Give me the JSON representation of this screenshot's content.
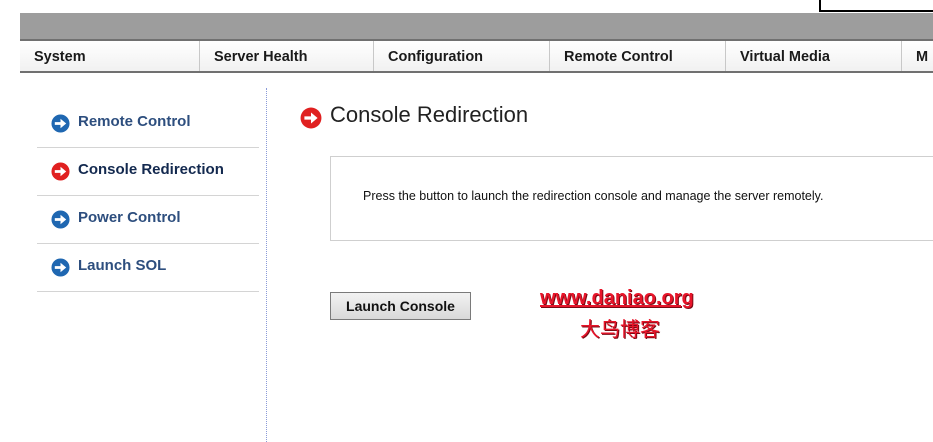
{
  "nav": {
    "tabs": [
      {
        "label": "System"
      },
      {
        "label": "Server Health"
      },
      {
        "label": "Configuration"
      },
      {
        "label": "Remote Control"
      },
      {
        "label": "Virtual Media"
      },
      {
        "label": "M"
      }
    ]
  },
  "sidebar": {
    "items": [
      {
        "label": "Remote Control",
        "icon": "arrow-right-circle-icon",
        "active": false
      },
      {
        "label": "Console Redirection",
        "icon": "arrow-right-circle-icon",
        "active": true
      },
      {
        "label": "Power Control",
        "icon": "arrow-right-circle-icon",
        "active": false
      },
      {
        "label": "Launch SOL",
        "icon": "arrow-right-circle-icon",
        "active": false
      }
    ]
  },
  "main": {
    "title": "Console Redirection",
    "description": "Press the button to launch the redirection console and manage the server remotely.",
    "launch_button_label": "Launch Console"
  },
  "watermark": {
    "url": "www.daniao.org",
    "caption": "大鸟博客"
  },
  "colors": {
    "icon_blue": "#1f67b1",
    "icon_red": "#e02020",
    "banner_gray": "#9d9d9d",
    "watermark_red": "#e8152a"
  }
}
